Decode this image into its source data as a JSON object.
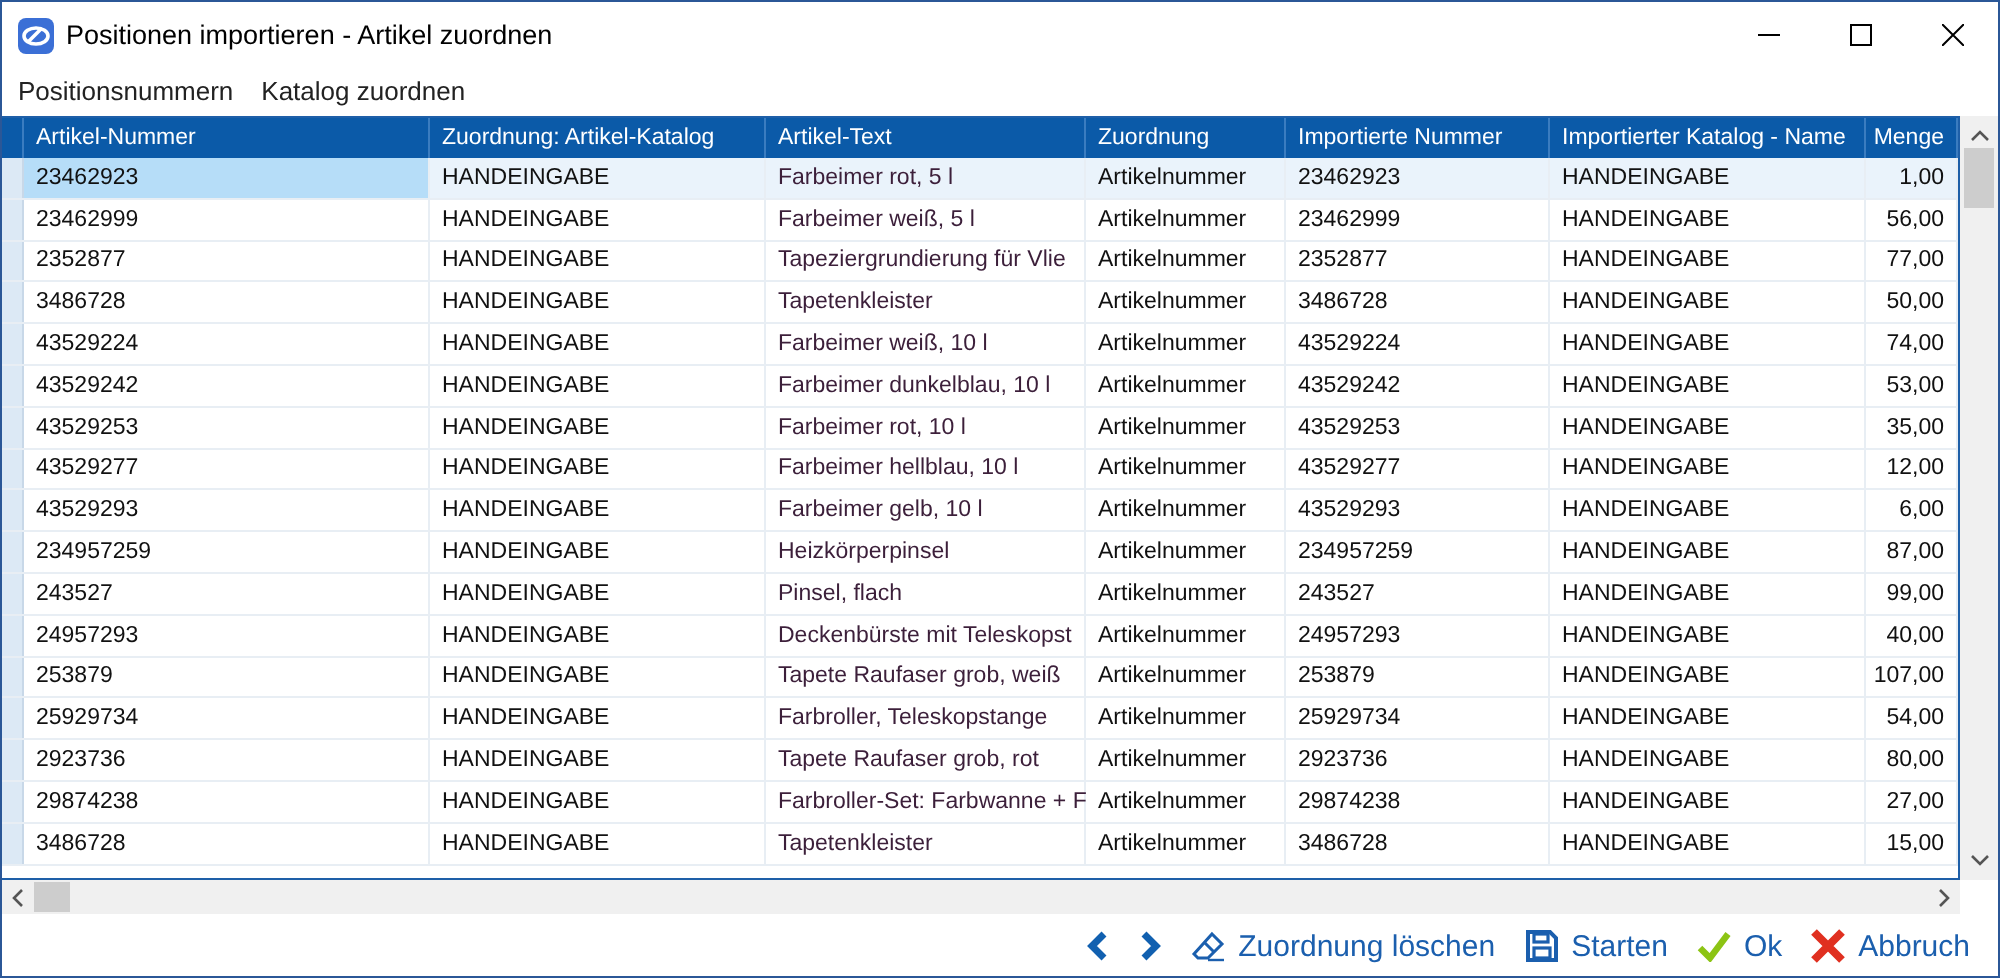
{
  "window": {
    "title": "Positionen importieren - Artikel zuordnen"
  },
  "menu": [
    "Positionsnummern",
    "Katalog zuordnen"
  ],
  "table": {
    "columns": [
      "Artikel-Nummer",
      "Zuordnung: Artikel-Katalog",
      "Artikel-Text",
      "Zuordnung",
      "Importierte Nummer",
      "Importierter Katalog - Name",
      "Menge"
    ],
    "rows": [
      {
        "selected": true,
        "cells": [
          "23462923",
          "HANDEINGABE",
          "Farbeimer rot, 5 l",
          "Artikelnummer",
          "23462923",
          "HANDEINGABE",
          "1,00"
        ]
      },
      {
        "selected": false,
        "cells": [
          "23462999",
          "HANDEINGABE",
          "Farbeimer weiß, 5 l",
          "Artikelnummer",
          "23462999",
          "HANDEINGABE",
          "56,00"
        ]
      },
      {
        "selected": false,
        "cells": [
          "2352877",
          "HANDEINGABE",
          "Tapeziergrundierung für Vlie",
          "Artikelnummer",
          "2352877",
          "HANDEINGABE",
          "77,00"
        ]
      },
      {
        "selected": false,
        "cells": [
          "3486728",
          "HANDEINGABE",
          "Tapetenkleister",
          "Artikelnummer",
          "3486728",
          "HANDEINGABE",
          "50,00"
        ]
      },
      {
        "selected": false,
        "cells": [
          "43529224",
          "HANDEINGABE",
          "Farbeimer weiß, 10 l",
          "Artikelnummer",
          "43529224",
          "HANDEINGABE",
          "74,00"
        ]
      },
      {
        "selected": false,
        "cells": [
          "43529242",
          "HANDEINGABE",
          "Farbeimer dunkelblau, 10 l",
          "Artikelnummer",
          "43529242",
          "HANDEINGABE",
          "53,00"
        ]
      },
      {
        "selected": false,
        "cells": [
          "43529253",
          "HANDEINGABE",
          "Farbeimer rot, 10 l",
          "Artikelnummer",
          "43529253",
          "HANDEINGABE",
          "35,00"
        ]
      },
      {
        "selected": false,
        "cells": [
          "43529277",
          "HANDEINGABE",
          "Farbeimer hellblau, 10 l",
          "Artikelnummer",
          "43529277",
          "HANDEINGABE",
          "12,00"
        ]
      },
      {
        "selected": false,
        "cells": [
          "43529293",
          "HANDEINGABE",
          "Farbeimer gelb, 10 l",
          "Artikelnummer",
          "43529293",
          "HANDEINGABE",
          "6,00"
        ]
      },
      {
        "selected": false,
        "cells": [
          "234957259",
          "HANDEINGABE",
          "Heizkörperpinsel",
          "Artikelnummer",
          "234957259",
          "HANDEINGABE",
          "87,00"
        ]
      },
      {
        "selected": false,
        "cells": [
          "243527",
          "HANDEINGABE",
          "Pinsel, flach",
          "Artikelnummer",
          "243527",
          "HANDEINGABE",
          "99,00"
        ]
      },
      {
        "selected": false,
        "cells": [
          "24957293",
          "HANDEINGABE",
          "Deckenbürste mit Teleskopst",
          "Artikelnummer",
          "24957293",
          "HANDEINGABE",
          "40,00"
        ]
      },
      {
        "selected": false,
        "cells": [
          "253879",
          "HANDEINGABE",
          "Tapete Raufaser grob, weiß",
          "Artikelnummer",
          "253879",
          "HANDEINGABE",
          "107,00"
        ]
      },
      {
        "selected": false,
        "cells": [
          "25929734",
          "HANDEINGABE",
          "Farbroller, Teleskopstange",
          "Artikelnummer",
          "25929734",
          "HANDEINGABE",
          "54,00"
        ]
      },
      {
        "selected": false,
        "cells": [
          "2923736",
          "HANDEINGABE",
          "Tapete Raufaser grob, rot",
          "Artikelnummer",
          "2923736",
          "HANDEINGABE",
          "80,00"
        ]
      },
      {
        "selected": false,
        "cells": [
          "29874238",
          "HANDEINGABE",
          "Farbroller-Set: Farbwanne + F",
          "Artikelnummer",
          "29874238",
          "HANDEINGABE",
          "27,00"
        ]
      },
      {
        "selected": false,
        "cells": [
          "3486728",
          "HANDEINGABE",
          "Tapetenkleister",
          "Artikelnummer",
          "3486728",
          "HANDEINGABE",
          "15,00"
        ]
      }
    ]
  },
  "toolbar": [
    {
      "kind": "prev"
    },
    {
      "kind": "next"
    },
    {
      "kind": "erase",
      "label": "Zuordnung löschen"
    },
    {
      "kind": "save",
      "label": "Starten"
    },
    {
      "kind": "ok",
      "label": "Ok"
    },
    {
      "kind": "cancel",
      "label": "Abbruch"
    }
  ]
}
